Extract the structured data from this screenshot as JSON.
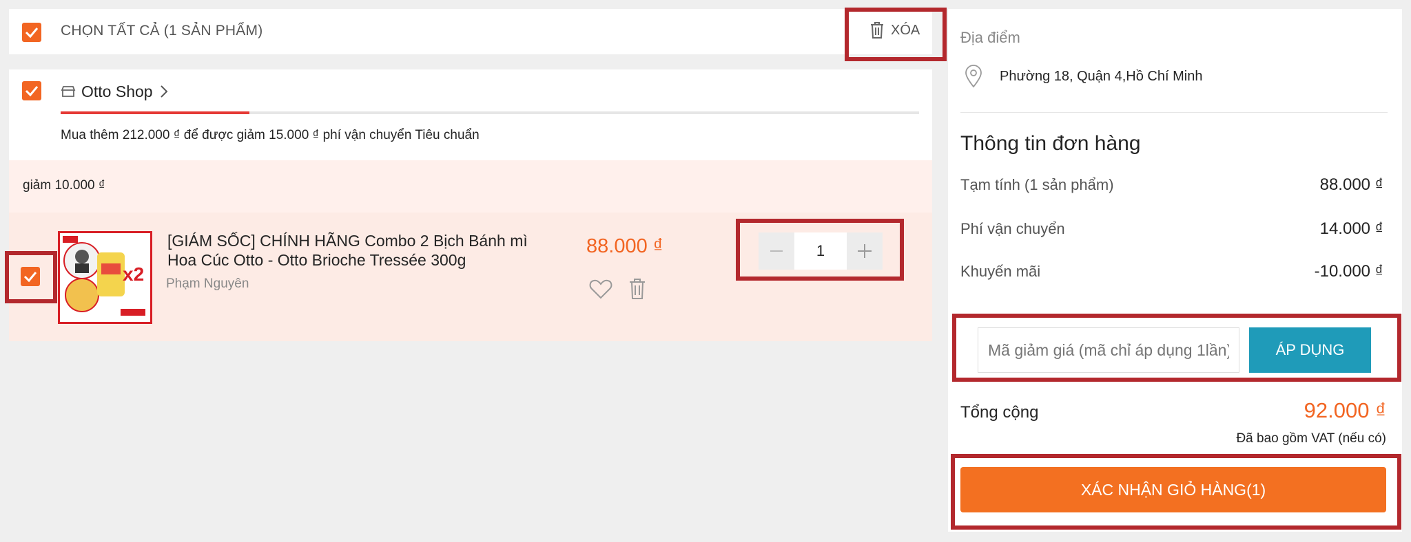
{
  "cart": {
    "select_all_label": "CHỌN TẤT CẢ (1 SẢN PHẨM)",
    "delete_all_label": "XÓA",
    "shop": {
      "name": "Otto Shop",
      "free_ship_text": "Mua thêm 212.000 ₫ để được giảm 15.000 ₫ phí vận chuyển Tiêu chuẩn",
      "free_ship_progress": 0.22
    },
    "promo_text": "giảm 10.000 ₫",
    "item": {
      "title": "[GIÁM SỐC] CHÍNH HÃNG Combo 2 Bịch Bánh mì Hoa Cúc Otto - Otto Brioche Tressée 300g",
      "seller": "Phạm Nguyên",
      "price": "88.000 ₫",
      "quantity": "1",
      "image_badge": "x2"
    }
  },
  "summary": {
    "location_label": "Địa điểm",
    "address": "Phường 18, Quận 4,Hồ Chí Minh",
    "order_title": "Thông tin đơn hàng",
    "rows": [
      {
        "label": "Tạm tính (1 sản phẩm)",
        "value": "88.000 ₫"
      },
      {
        "label": "Phí vận chuyển",
        "value": "14.000 ₫"
      },
      {
        "label": "Khuyến mãi",
        "value": "-10.000 ₫"
      }
    ],
    "coupon_placeholder": "Mã giảm giá (mã chỉ áp dụng 1lần)",
    "apply_label": "ÁP DỤNG",
    "total_label": "Tổng cộng",
    "total_value": "92.000 ₫",
    "vat_note": "Đã bao gồm VAT (nếu có)",
    "confirm_label": "XÁC NHẬN GIỎ HÀNG(1)"
  },
  "colors": {
    "accent": "#f26522",
    "apply_button": "#1f9bb9",
    "highlight_box": "#b3282d"
  }
}
